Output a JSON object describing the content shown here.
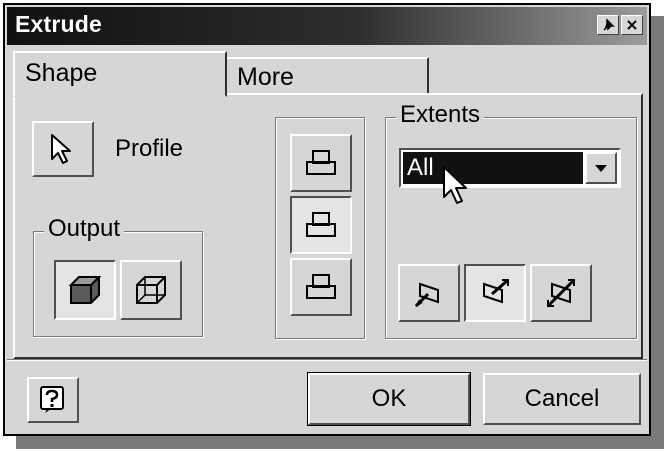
{
  "window": {
    "title": "Extrude"
  },
  "tabs": [
    {
      "label": "Shape",
      "active": true
    },
    {
      "label": "More",
      "active": false
    }
  ],
  "profile": {
    "label": "Profile",
    "icon": "select-arrow-icon"
  },
  "output": {
    "legend": "Output",
    "options": [
      {
        "name": "solid",
        "icon": "solid-box-icon",
        "selected": true
      },
      {
        "name": "surface",
        "icon": "surface-box-icon",
        "selected": false
      }
    ]
  },
  "operation": {
    "options": [
      {
        "name": "join",
        "icon": "join-icon",
        "selected": false
      },
      {
        "name": "cut",
        "icon": "cut-icon",
        "selected": true
      },
      {
        "name": "intersect",
        "icon": "intersect-icon",
        "selected": false
      }
    ]
  },
  "extents": {
    "legend": "Extents",
    "selected": "All",
    "directions": [
      {
        "name": "direction-1",
        "icon": "direction-1-icon",
        "selected": false
      },
      {
        "name": "direction-2",
        "icon": "direction-2-icon",
        "selected": true
      },
      {
        "name": "symmetric",
        "icon": "symmetric-icon",
        "selected": false
      }
    ]
  },
  "footer": {
    "ok_label": "OK",
    "cancel_label": "Cancel"
  }
}
